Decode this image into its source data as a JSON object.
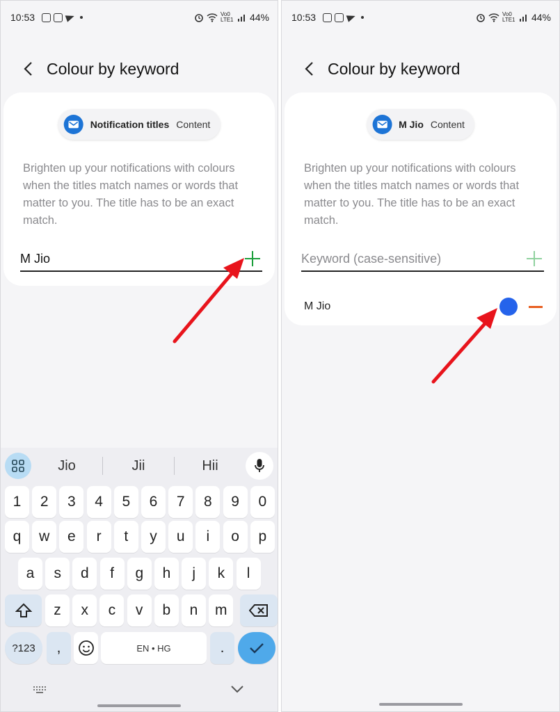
{
  "left": {
    "status": {
      "time": "10:53",
      "battery": "44%",
      "network": "Vo0 LTE1"
    },
    "title": "Colour by keyword",
    "chip": {
      "title": "Notification titles",
      "content": "Content"
    },
    "description": "Brighten up your notifications with colours when the titles match names or words that matter to you. The title has to be an exact match.",
    "keyword_value": "M Jio",
    "add_color": "#1a9e3a",
    "keyboard": {
      "suggestions": [
        "Jio",
        "Jii",
        "Hii"
      ],
      "numbers": [
        "1",
        "2",
        "3",
        "4",
        "5",
        "6",
        "7",
        "8",
        "9",
        "0"
      ],
      "row1": [
        "q",
        "w",
        "e",
        "r",
        "t",
        "y",
        "u",
        "i",
        "o",
        "p"
      ],
      "row2": [
        "a",
        "s",
        "d",
        "f",
        "g",
        "h",
        "j",
        "k",
        "l"
      ],
      "row3": [
        "z",
        "x",
        "c",
        "v",
        "b",
        "n",
        "m"
      ],
      "sym_label": "?123",
      "comma": ",",
      "space_label": "EN • HG",
      "period": "."
    }
  },
  "right": {
    "status": {
      "time": "10:53",
      "battery": "44%",
      "network": "Vo0 LTE1"
    },
    "title": "Colour by keyword",
    "chip": {
      "title": "M Jio",
      "content": "Content"
    },
    "description": "Brighten up your notifications with colours when the titles match names or words that matter to you. The title has to be an exact match.",
    "keyword_placeholder": "Keyword (case-sensitive)",
    "add_color": "#8fd19e",
    "entry": {
      "label": "M Jio",
      "color": "#2563eb"
    },
    "remove_color": "#e85d1f"
  },
  "annotation_color": "#e8141c"
}
